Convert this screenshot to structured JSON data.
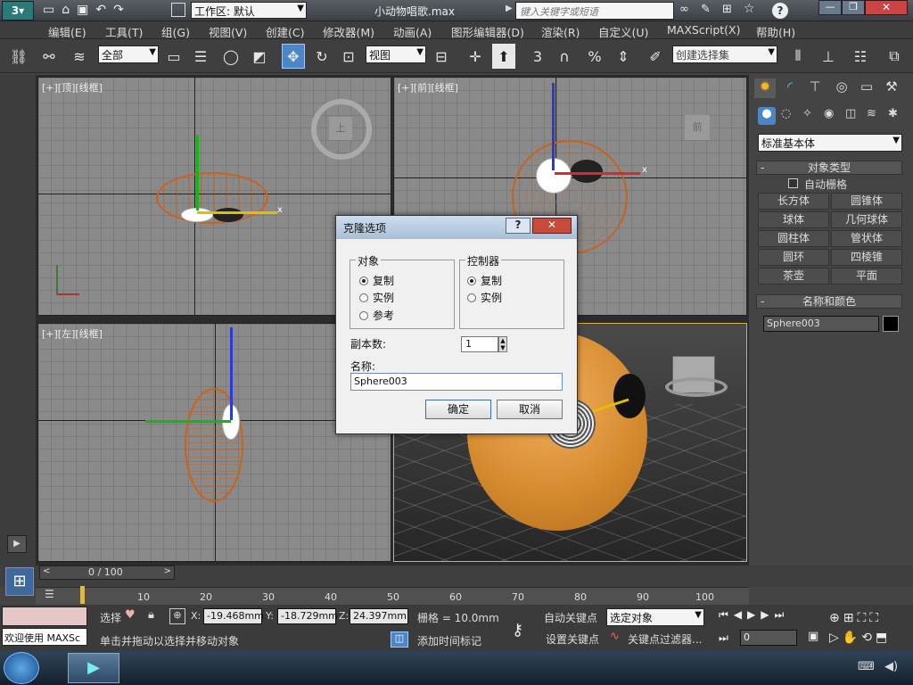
{
  "titlebar": {
    "workspace_label": "工作区: 默认",
    "file_name": "小动物唱歌.max",
    "search_placeholder": "键入关键字或短语"
  },
  "menu": [
    "编辑(E)",
    "工具(T)",
    "组(G)",
    "视图(V)",
    "创建(C)",
    "修改器(M)",
    "动画(A)",
    "图形编辑器(D)",
    "渲染(R)",
    "自定义(U)",
    "MAXScript(X)",
    "帮助(H)"
  ],
  "toolbar": {
    "filter_value": "全部",
    "refcoord_value": "视图",
    "named_selection_placeholder": "创建选择集",
    "snap_label": "3",
    "percent_label": "%"
  },
  "viewports": {
    "top": "[+][顶][线框]",
    "front": "[+][前][线框]",
    "left": "[+][左][线框]",
    "viewcube_top": "上",
    "viewcube_front": "前"
  },
  "cmdpanel": {
    "category": "标准基本体",
    "object_type_title": "对象类型",
    "autogrid_label": "自动栅格",
    "buttons": [
      "长方体",
      "圆锥体",
      "球体",
      "几何球体",
      "圆柱体",
      "管状体",
      "圆环",
      "四棱锥",
      "茶壶",
      "平面"
    ],
    "name_color_title": "名称和颜色",
    "object_name": "Sphere003",
    "object_color": "#000000"
  },
  "dialog": {
    "title": "克隆选项",
    "object_group": "对象",
    "object_options": [
      "复制",
      "实例",
      "参考"
    ],
    "controller_group": "控制器",
    "controller_options": [
      "复制",
      "实例"
    ],
    "copies_label": "副本数:",
    "copies_value": "1",
    "name_label": "名称:",
    "name_value": "Sphere003",
    "ok": "确定",
    "cancel": "取消"
  },
  "timeline": {
    "frame_display": "0 / 100",
    "ticks": [
      "10",
      "20",
      "30",
      "40",
      "50",
      "60",
      "70",
      "80",
      "90",
      "100"
    ]
  },
  "status": {
    "welcome": "欢迎使用 MAXSc",
    "select_label": "选择",
    "x_label": "X:",
    "x_value": "-19.468mm",
    "y_label": "Y:",
    "y_value": "-18.729mm",
    "z_label": "Z:",
    "z_value": "24.397mm",
    "grid_text": "栅格 = 10.0mm",
    "prompt": "单击并拖动以选择并移动对象",
    "add_time_tag": "添加时间标记",
    "auto_key": "自动关键点",
    "selected_dropdown": "选定对象",
    "set_key": "设置关键点",
    "key_filters": "关键点过滤器...",
    "frame_value": "0"
  }
}
